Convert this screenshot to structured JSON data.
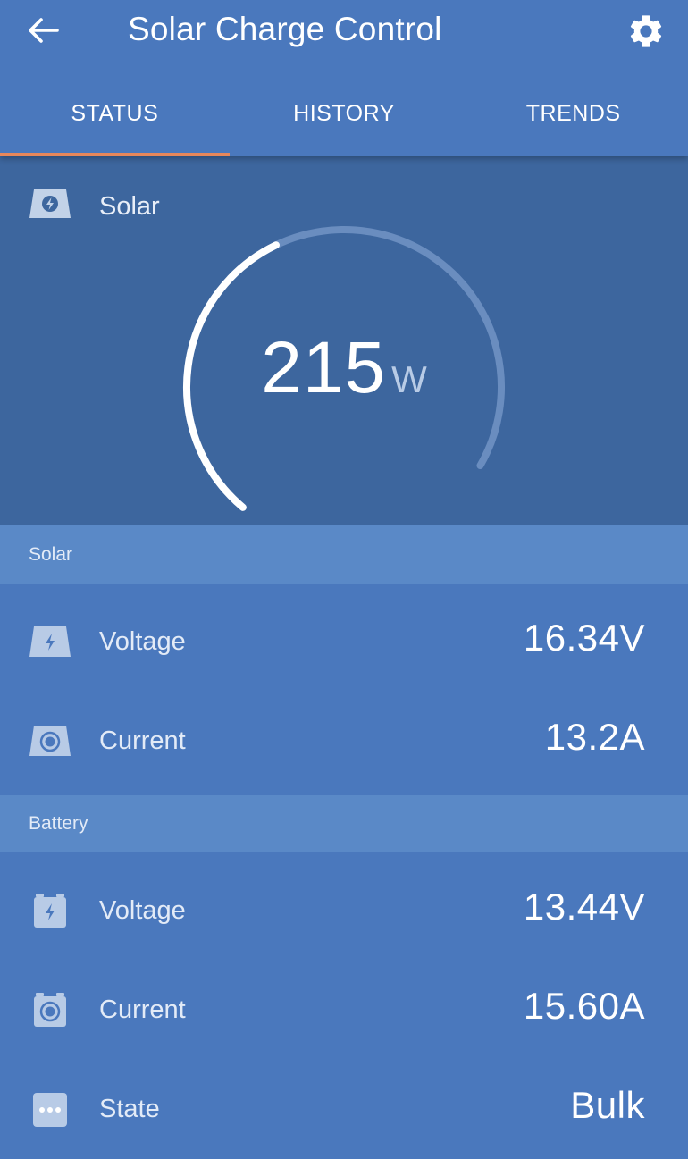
{
  "header": {
    "title": "Solar Charge Control"
  },
  "tabs": [
    {
      "label": "STATUS",
      "active": true
    },
    {
      "label": "HISTORY",
      "active": false
    },
    {
      "label": "TRENDS",
      "active": false
    }
  ],
  "gauge": {
    "label": "Solar",
    "value": "215",
    "unit": "W",
    "fill_fraction": 0.44
  },
  "solar_section": {
    "title": "Solar",
    "voltage": {
      "label": "Voltage",
      "value": "16.34V"
    },
    "current": {
      "label": "Current",
      "value": "13.2A"
    }
  },
  "battery_section": {
    "title": "Battery",
    "voltage": {
      "label": "Voltage",
      "value": "13.44V"
    },
    "current": {
      "label": "Current",
      "value": "15.60A"
    },
    "state": {
      "label": "State",
      "value": "Bulk"
    }
  },
  "colors": {
    "background": "#4a78bd",
    "gauge_panel": "#3d669e",
    "section_header": "#5a89c7",
    "tab_indicator": "#e8875a"
  }
}
